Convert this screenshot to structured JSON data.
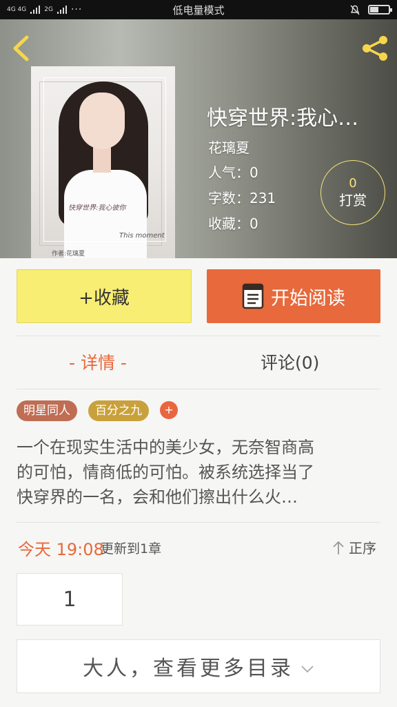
{
  "status_bar": {
    "network_label_1": "4G 4G",
    "network_label_2": "2G",
    "dots": "···",
    "mode": "低电量模式",
    "battery_level": 0.45
  },
  "book": {
    "title": "快穿世界:我心…",
    "author": "花璃夏",
    "popularity": "人气：0",
    "word_count": "字数：231",
    "favorites": "收藏：0",
    "cover_title": "快穿世界:我心彼你",
    "cover_signature": "This moment",
    "cover_author": "作者:花璃夏"
  },
  "reward": {
    "count": "0",
    "label": "打赏"
  },
  "actions": {
    "collect_label": "+收藏",
    "read_label": "开始阅读"
  },
  "tabs": [
    {
      "label": "- 详情 -"
    },
    {
      "label": "评论(0)"
    }
  ],
  "tags": [
    {
      "label": "明星同人"
    },
    {
      "label": "百分之九"
    }
  ],
  "tag_add": "+",
  "description": {
    "line1": "一个在现实生活中的美少女，无奈智商高",
    "line2": "的可怕，情商低的可怕。被系统选择当了",
    "line3": "快穿界的一名，会和他们擦出什么火…"
  },
  "update": {
    "time": "今天 19:08",
    "text": "更新到1章",
    "sort_label": "正序"
  },
  "chapters": [
    {
      "label": "1"
    }
  ],
  "more_toc_label": "大人，查看更多目录",
  "colors": {
    "accent": "#e7693c",
    "collect_yellow": "#f7ee73",
    "tag_brown": "#bf6d53",
    "tag_gold": "#c9a13c"
  }
}
